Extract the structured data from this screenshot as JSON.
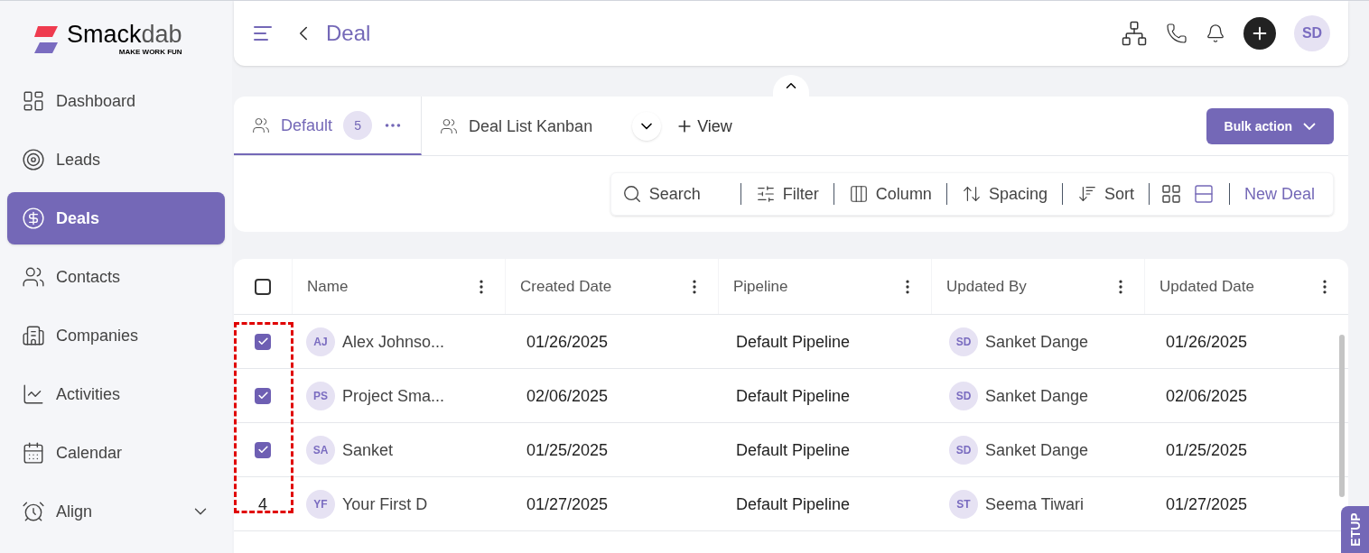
{
  "brand": {
    "name_bold": "Smack",
    "name_light": "dab",
    "tagline": "MAKE WORK FUN"
  },
  "sidebar": {
    "items": [
      {
        "label": "Dashboard",
        "kind": "dashboard",
        "selected": false
      },
      {
        "label": "Leads",
        "kind": "leads",
        "selected": false
      },
      {
        "label": "Deals",
        "kind": "deals",
        "selected": true
      },
      {
        "label": "Contacts",
        "kind": "contacts",
        "selected": false
      },
      {
        "label": "Companies",
        "kind": "companies",
        "selected": false
      },
      {
        "label": "Activities",
        "kind": "activities",
        "selected": false
      },
      {
        "label": "Calendar",
        "kind": "calendar",
        "selected": false
      },
      {
        "label": "Align",
        "kind": "align",
        "selected": false,
        "expandable": true
      }
    ]
  },
  "header": {
    "title": "Deal",
    "avatar": "SD"
  },
  "views": {
    "tabs": [
      {
        "label": "Default",
        "count": "5",
        "selected": true
      },
      {
        "label": "Deal List Kanban",
        "selected": false
      }
    ],
    "add_view": "View",
    "bulk_action": "Bulk action"
  },
  "toolbar": {
    "search": "Search",
    "items": [
      {
        "label": "Filter",
        "kind": "filter"
      },
      {
        "label": "Column",
        "kind": "column"
      },
      {
        "label": "Spacing",
        "kind": "spacing"
      },
      {
        "label": "Sort",
        "kind": "sort"
      }
    ],
    "new": "New Deal"
  },
  "table": {
    "select_all": false,
    "columns": [
      "Name",
      "Created Date",
      "Pipeline",
      "Updated By",
      "Updated Date"
    ],
    "rows": [
      {
        "checked": true,
        "initials": "AJ",
        "name": "Alex Johnso...",
        "created": "01/26/2025",
        "pipeline": "Default Pipeline",
        "by_initials": "SD",
        "by": "Sanket Dange",
        "updated": "01/26/2025"
      },
      {
        "checked": true,
        "initials": "PS",
        "name": "Project Sma...",
        "created": "02/06/2025",
        "pipeline": "Default Pipeline",
        "by_initials": "SD",
        "by": "Sanket Dange",
        "updated": "02/06/2025"
      },
      {
        "checked": true,
        "initials": "SA",
        "name": "Sanket",
        "created": "01/25/2025",
        "pipeline": "Default Pipeline",
        "by_initials": "SD",
        "by": "Sanket Dange",
        "updated": "01/25/2025"
      },
      {
        "number": "4",
        "initials": "YF",
        "name": "Your First D",
        "created": "01/27/2025",
        "pipeline": "Default Pipeline",
        "by_initials": "ST",
        "by": "Seema Tiwari",
        "updated": "01/27/2025"
      }
    ]
  },
  "setup_tab": "ETUP"
}
